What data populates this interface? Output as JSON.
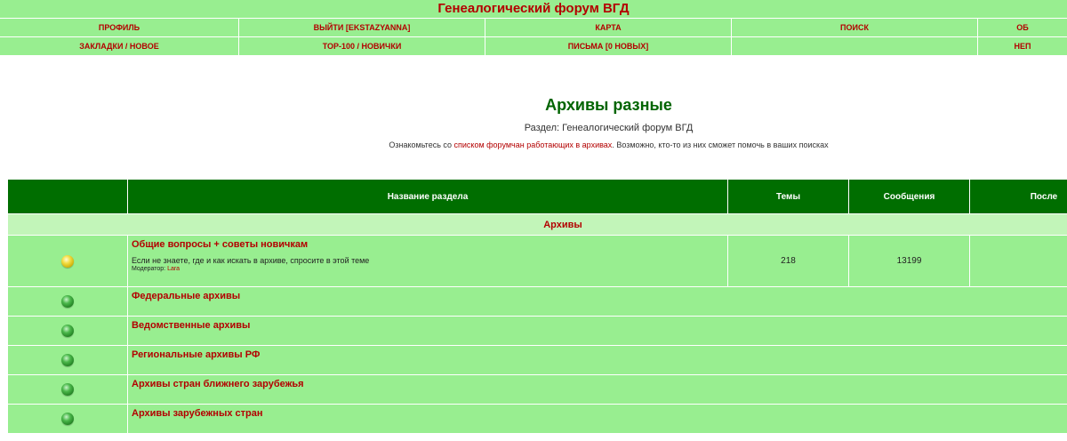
{
  "header": {
    "site_title": "Генеалогический форум ВГД",
    "nav_row1": [
      "ПРОФИЛЬ",
      "ВЫЙТИ [EKSTAZYANNA]",
      "КАРТА",
      "ПОИСК",
      "ОБ"
    ],
    "nav_row2": [
      "ЗАКЛАДКИ / НОВОЕ",
      "TOP-100 / НОВИЧКИ",
      "ПИСЬМА [0 НОВЫХ]",
      "",
      "НЕП"
    ]
  },
  "page": {
    "title": "Архивы разные",
    "section_label": "Раздел: Генеалогический форум ВГД",
    "notice_before": "Ознакомьтесь со ",
    "notice_link": "списком форумчан работающих в архивах",
    "notice_after": ". Возможно, кто-то из них сможет помочь в ваших поисках"
  },
  "table": {
    "headers": {
      "name": "Название раздела",
      "topics": "Темы",
      "messages": "Сообщения",
      "last": "После"
    },
    "category": "Архивы",
    "forums": [
      {
        "name": "Общие вопросы + советы новичкам",
        "description": "Если не знаете, где и как искать в архиве, спросите в этой теме",
        "moderator_label": "Модератор: ",
        "moderator": "Lara",
        "topics": "218",
        "messages": "13199",
        "icon": "yellow-bulb"
      },
      {
        "name": "Федеральные архивы",
        "icon": "green-bulb"
      },
      {
        "name": "Ведомственные архивы",
        "icon": "green-bulb"
      },
      {
        "name": "Региональные архивы РФ",
        "icon": "green-bulb"
      },
      {
        "name": "Архивы стран ближнего зарубежья",
        "icon": "green-bulb"
      },
      {
        "name": "Архивы зарубежных стран",
        "icon": "green-bulb"
      }
    ]
  },
  "colors": {
    "header_bg": "#98ee90",
    "table_header_bg": "#006e00",
    "category_bg": "#c2f5b9",
    "link_red": "#b30000",
    "title_green": "#006400"
  }
}
